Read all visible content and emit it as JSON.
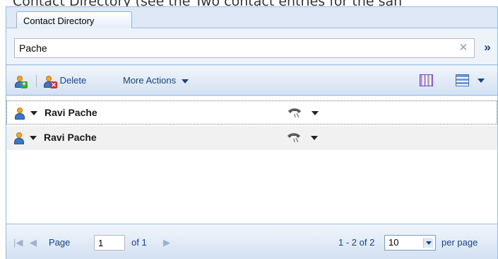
{
  "caption": "Contact Directory (see the Two contact entries for the san",
  "tab": {
    "label": "Contact Directory"
  },
  "search": {
    "value": "Pache",
    "clear_icon": "close-icon",
    "expand_icon": "double-chevron-down-icon"
  },
  "toolbar": {
    "add_icon": "add-contact-icon",
    "delete_label": "Delete",
    "more_actions_label": "More Actions",
    "grid_icon": "grid-view-icon",
    "list_icon": "list-view-icon"
  },
  "contacts": [
    {
      "name": "Ravi Pache",
      "icon": "person-icon",
      "phone_icon": "phone-icon"
    },
    {
      "name": "Ravi Pache",
      "icon": "person-icon",
      "phone_icon": "phone-icon"
    }
  ],
  "pager": {
    "page_label": "Page",
    "page_value": "1",
    "of_label": "of 1",
    "count_label": "1 - 2 of 2",
    "per_page_value": "10",
    "per_page_label": "per page"
  },
  "colors": {
    "border": "#99bbe8",
    "accent": "#15428b",
    "background": "#dfe8f6"
  }
}
